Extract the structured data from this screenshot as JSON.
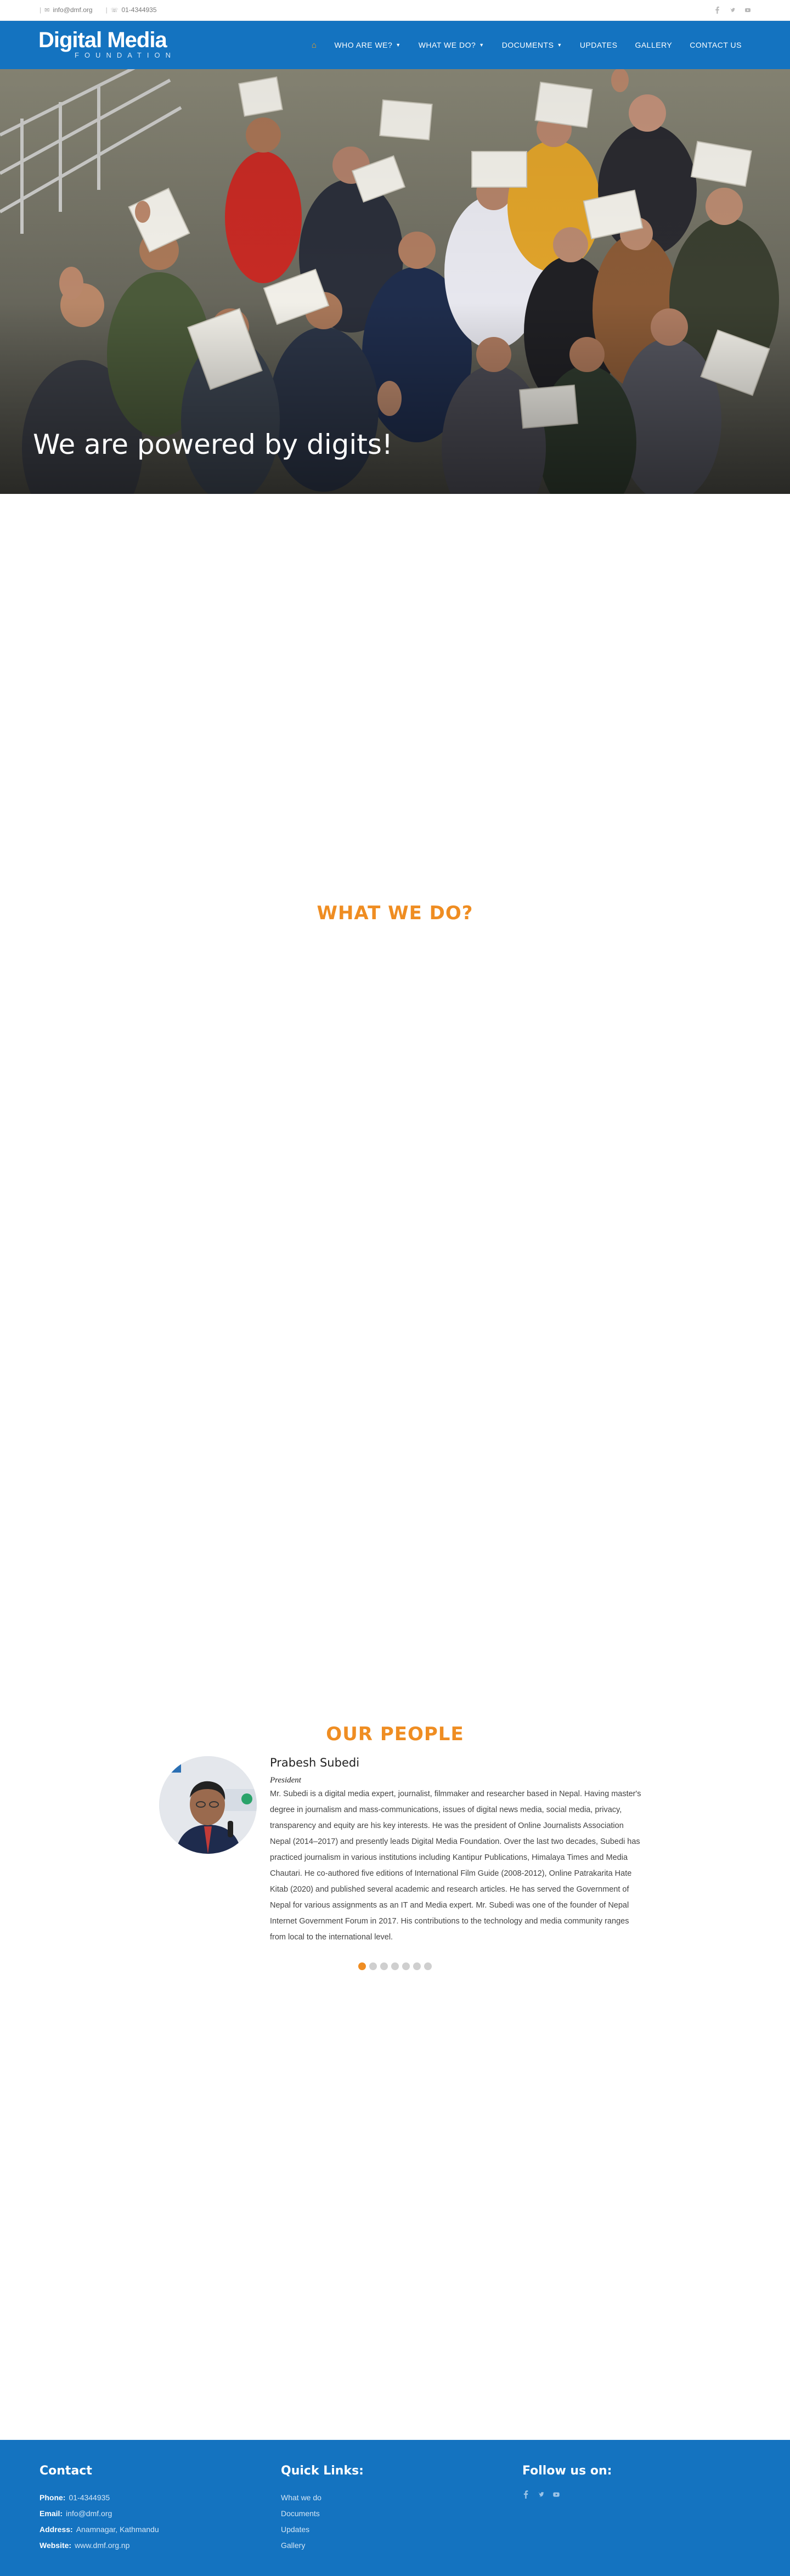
{
  "topbar": {
    "email": "info@dmf.org",
    "phone": "01-4344935",
    "social_icons": [
      "facebook-icon",
      "twitter-icon",
      "youtube-icon"
    ]
  },
  "header": {
    "logo_main": "Digital Media",
    "logo_sub": "FOUNDATION",
    "nav": [
      {
        "label": "",
        "icon": "home-icon"
      },
      {
        "label": "WHO ARE WE?",
        "dropdown": true
      },
      {
        "label": "WHAT WE DO?",
        "dropdown": true
      },
      {
        "label": "DOCUMENTS",
        "dropdown": true
      },
      {
        "label": "UPDATES"
      },
      {
        "label": "GALLERY"
      },
      {
        "label": "CONTACT US"
      }
    ],
    "accent": "#f7a11a",
    "bar_color": "#1473c0"
  },
  "hero": {
    "tagline": "We are powered by digits!"
  },
  "what_we_do": {
    "title": "WHAT WE DO?"
  },
  "people": {
    "title": "OUR PEOPLE",
    "name": "Prabesh Subedi",
    "role": "President",
    "bio": "Mr. Subedi is a digital media expert, journalist, filmmaker and researcher based in Nepal. Having master's degree in journalism and mass-communications, issues of digital news media, social media, privacy, transparency and equity are his key interests. He was the president of Online Journalists Association Nepal (2014–2017) and presently leads Digital Media Foundation. Over the last two decades, Subedi has practiced journalism in various institutions including Kantipur Publications, Himalaya Times and Media Chautari. He co-authored five editions of International Film Guide (2008-2012), Online Patrakarita Hate Kitab (2020) and published several academic and research articles. He has served the Government of Nepal for various assignments as an IT and Media expert. Mr. Subedi was one of the founder of Nepal Internet Government Forum in 2017. His contributions to the technology and media community ranges from local to the international level.",
    "slides_total": 7,
    "slide_active": 1
  },
  "footer": {
    "contact_title": "Contact",
    "phone_label": "Phone:",
    "phone": "01-4344935",
    "email_label": "Email:",
    "email": "info@dmf.org",
    "address_label": "Address:",
    "address": "Anamnagar, Kathmandu",
    "website_label": "Website:",
    "website": "www.dmf.org.np",
    "links_title": "Quick Links:",
    "links": [
      "What we do",
      "Documents",
      "Updates",
      "Gallery"
    ],
    "follow_title": "Follow us on:",
    "social_icons": [
      "facebook-icon",
      "twitter-icon",
      "youtube-icon"
    ]
  }
}
